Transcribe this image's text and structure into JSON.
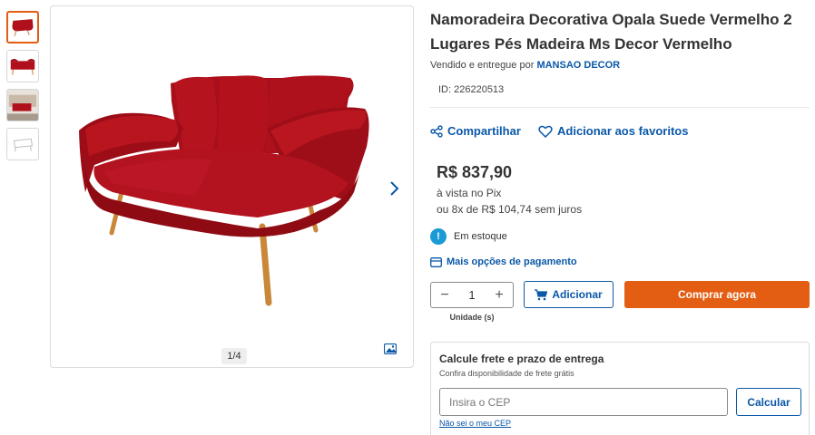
{
  "product": {
    "title": "Namoradeira Decorativa Opala Suede Vermelho 2 Lugares Pés Madeira Ms Decor Vermelho",
    "seller_prefix": "Vendido e entregue por",
    "seller_name": "MANSAO DECOR",
    "id_text": "ID: 226220513"
  },
  "gallery": {
    "thumbnails": [
      {
        "icon": "sofa-thumbnail"
      },
      {
        "icon": "sofa-side-thumbnail"
      },
      {
        "icon": "room-thumbnail"
      },
      {
        "icon": "dimensions-thumbnail"
      }
    ],
    "counter": "1/4",
    "next_icon": "chevron-right-icon",
    "zoom_icon": "image-icon"
  },
  "actions": {
    "share_label": "Compartilhar",
    "favorite_label": "Adicionar aos favoritos"
  },
  "pricing": {
    "price": "R$ 837,90",
    "pix_text": "à vista no Pix",
    "installments": "ou 8x de R$ 104,74 sem juros"
  },
  "stock": {
    "icon_glyph": "!",
    "text": "Em estoque"
  },
  "payment": {
    "more_options": "Mais opções de pagamento"
  },
  "cart": {
    "quantity": "1",
    "minus": "−",
    "plus": "+",
    "unit_label": "Unidade (s)",
    "add_label": "Adicionar",
    "buy_label": "Comprar agora"
  },
  "freight": {
    "title": "Calcule frete e prazo de entrega",
    "subtitle": "Confira disponibilidade de frete grátis",
    "cep_placeholder": "Insira o CEP",
    "calc_label": "Calcular",
    "no_cep_link": "Não sei o meu CEP"
  },
  "colors": {
    "accent_blue": "#0a58a8",
    "buy_orange": "#e35d12",
    "sofa_red": "#b0101b",
    "stock_blue": "#1b9ad6"
  }
}
